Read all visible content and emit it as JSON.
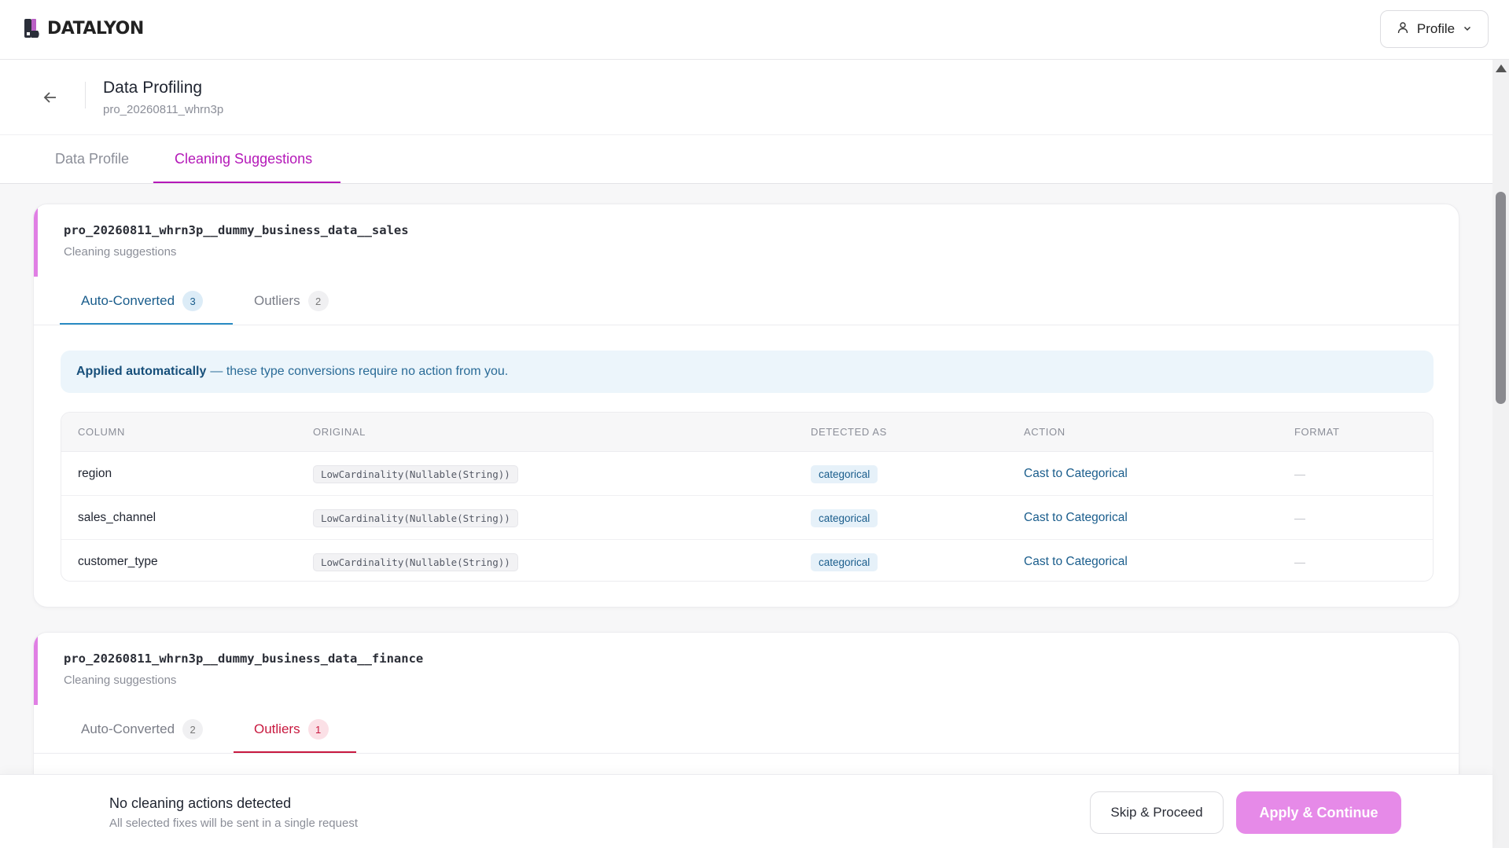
{
  "brand": {
    "name": "DATALYON"
  },
  "header": {
    "profile_label": "Profile"
  },
  "page": {
    "title": "Data Profiling",
    "subtitle": "pro_20260811_whrn3p"
  },
  "main_tabs": [
    {
      "label": "Data Profile",
      "active": false
    },
    {
      "label": "Cleaning Suggestions",
      "active": true
    }
  ],
  "cards": [
    {
      "title": "pro_20260811_whrn3p__dummy_business_data__sales",
      "subtitle": "Cleaning suggestions",
      "tabs": [
        {
          "label": "Auto-Converted",
          "count": "3",
          "active": true
        },
        {
          "label": "Outliers",
          "count": "2",
          "active": false
        }
      ],
      "banner": {
        "bold": "Applied automatically",
        "text": "— these type conversions require no action from you."
      },
      "columns": [
        "COLUMN",
        "ORIGINAL",
        "DETECTED AS",
        "ACTION",
        "FORMAT"
      ],
      "rows": [
        {
          "column": "region",
          "original": "LowCardinality(Nullable(String))",
          "detected": "categorical",
          "action": "Cast to Categorical",
          "format": "—"
        },
        {
          "column": "sales_channel",
          "original": "LowCardinality(Nullable(String))",
          "detected": "categorical",
          "action": "Cast to Categorical",
          "format": "—"
        },
        {
          "column": "customer_type",
          "original": "LowCardinality(Nullable(String))",
          "detected": "categorical",
          "action": "Cast to Categorical",
          "format": "—"
        }
      ]
    },
    {
      "title": "pro_20260811_whrn3p__dummy_business_data__finance",
      "subtitle": "Cleaning suggestions",
      "tabs": [
        {
          "label": "Auto-Converted",
          "count": "2",
          "active": false
        },
        {
          "label": "Outliers",
          "count": "1",
          "active": true
        }
      ]
    }
  ],
  "footer": {
    "title": "No cleaning actions detected",
    "subtitle": "All selected fixes will be sent in a single request",
    "skip_label": "Skip & Proceed",
    "apply_label": "Apply & Continue"
  },
  "colors": {
    "accent": "#b418b8",
    "link": "#1a5d8c",
    "danger": "#c8193f",
    "apply": "#e68ae8"
  }
}
